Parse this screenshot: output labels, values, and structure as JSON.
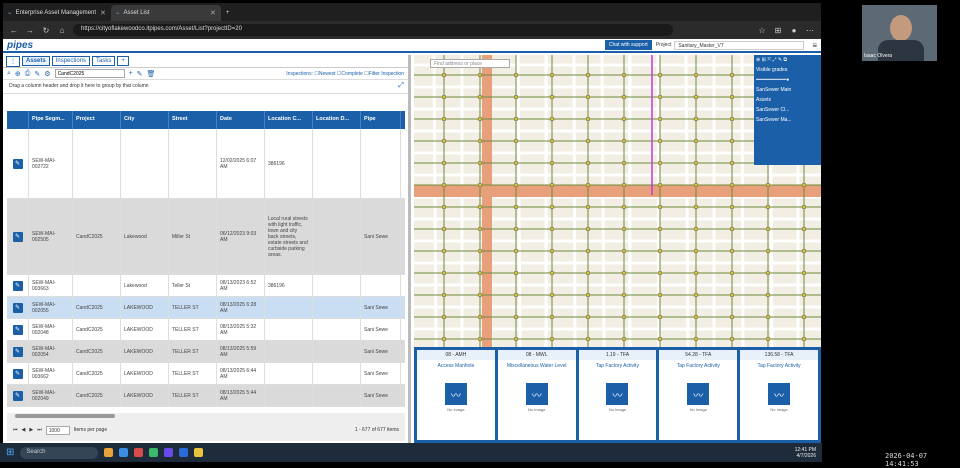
{
  "browser": {
    "tabs": [
      {
        "label": "Enterprise Asset Management",
        "active": false
      },
      {
        "label": "Asset List",
        "active": true
      }
    ],
    "url": "https://cityoflakewoodco.itpipes.com/Asset/List?projectID=20"
  },
  "app": {
    "logo": "pipes",
    "chat_label": "Chat with support",
    "project_label": "Project",
    "project_value": "Sanitary_Master_V7"
  },
  "left_tabs": [
    "Assets",
    "Inspections",
    "Tasks"
  ],
  "toolbar": {
    "selection_set": "CandC2025",
    "inspections_label": "Inspections:",
    "filter_opts": [
      "Newest",
      "Complete",
      "Filter Inspection"
    ]
  },
  "drag_hint": "Drag a column header and drop it here to group by that column",
  "grid": {
    "columns": [
      "",
      "Pipe Segm...",
      "Project",
      "City",
      "Street",
      "Date",
      "Location C...",
      "Location D...",
      "Pipe"
    ],
    "rows": [
      {
        "id": "SEW-MAI-002722",
        "project": "",
        "city": "",
        "street": "",
        "date": "12/02/2025 6:07 AM",
        "loc": "386196",
        "locd": "",
        "pipe": "",
        "style": ""
      },
      {
        "id": "SEW-MAI-002505",
        "project": "CandC2025",
        "city": "Lakewood",
        "street": "Miller St",
        "date": "06/12/2023 9:03 AM",
        "loc": "Local rural streets with light traffic, town and city back streets, estate streets and curbside parking areas.",
        "locd": "",
        "pipe": "Sani Sewe",
        "style": "grey"
      },
      {
        "id": "SEW-MAI-003663",
        "project": "",
        "city": "Lakewood",
        "street": "Teller St",
        "date": "08/13/2023 6:52 AM",
        "loc": "386196",
        "locd": "",
        "pipe": "",
        "style": ""
      },
      {
        "id": "SEW-MAI-002055",
        "project": "CandC2025",
        "city": "LAKEWOOD",
        "street": "TELLER ST",
        "date": "08/13/2025 6:28 AM",
        "loc": "",
        "locd": "",
        "pipe": "Sani Sewe",
        "style": "sel"
      },
      {
        "id": "SEW-MAI-002048",
        "project": "CandC2025",
        "city": "LAKEWOOD",
        "street": "TELLER ST",
        "date": "08/13/2025 5:32 AM",
        "loc": "",
        "locd": "",
        "pipe": "Sani Sewe",
        "style": ""
      },
      {
        "id": "SEW-MAI-002054",
        "project": "CandC2025",
        "city": "LAKEWOOD",
        "street": "TELLER ST",
        "date": "08/13/2025 5:59 AM",
        "loc": "",
        "locd": "",
        "pipe": "Sani Sewe",
        "style": "grey"
      },
      {
        "id": "SEW-MAI-003662",
        "project": "CandC2025",
        "city": "LAKEWOOD",
        "street": "TELLER ST",
        "date": "08/13/2025 6:44 AM",
        "loc": "",
        "locd": "",
        "pipe": "Sani Sewe",
        "style": ""
      },
      {
        "id": "SEW-MAI-002049",
        "project": "CandC2025",
        "city": "LAKEWOOD",
        "street": "TELLER ST",
        "date": "08/13/2025 5:44 AM",
        "loc": "",
        "locd": "",
        "pipe": "Sani Sewe",
        "style": "grey"
      }
    ]
  },
  "pager": {
    "page_size": "1000",
    "items_label": "Items per page",
    "count": "1 - 677 of 677 items"
  },
  "map": {
    "search_placeholder": "Find address or place",
    "layer_title": "Visible grades",
    "layers": [
      "SanSewer Main",
      "Assets",
      "SanSewer Cl...",
      "SanSewer Ma..."
    ]
  },
  "cards": [
    {
      "top": "08 - AMH",
      "title": "Access Manhole",
      "noimg": "No Image"
    },
    {
      "top": "08 - MWL",
      "title": "Miscellaneous Water Level",
      "noimg": "No Image"
    },
    {
      "top": "1.19 - TFA",
      "title": "Tap Factory Activity",
      "noimg": "No Image"
    },
    {
      "top": "54.28 - TFA",
      "title": "Tap Factory Activity",
      "noimg": "No Image"
    },
    {
      "top": "136.58 - TFA",
      "title": "Tap Factory Activity",
      "noimg": "No Image"
    }
  ],
  "taskbar": {
    "search": "Search",
    "time": "12:41 PM",
    "date": "4/7/2026"
  },
  "webcam_name": "Isaac Olvera",
  "timestamp": "2026-04-07 14:41:53"
}
